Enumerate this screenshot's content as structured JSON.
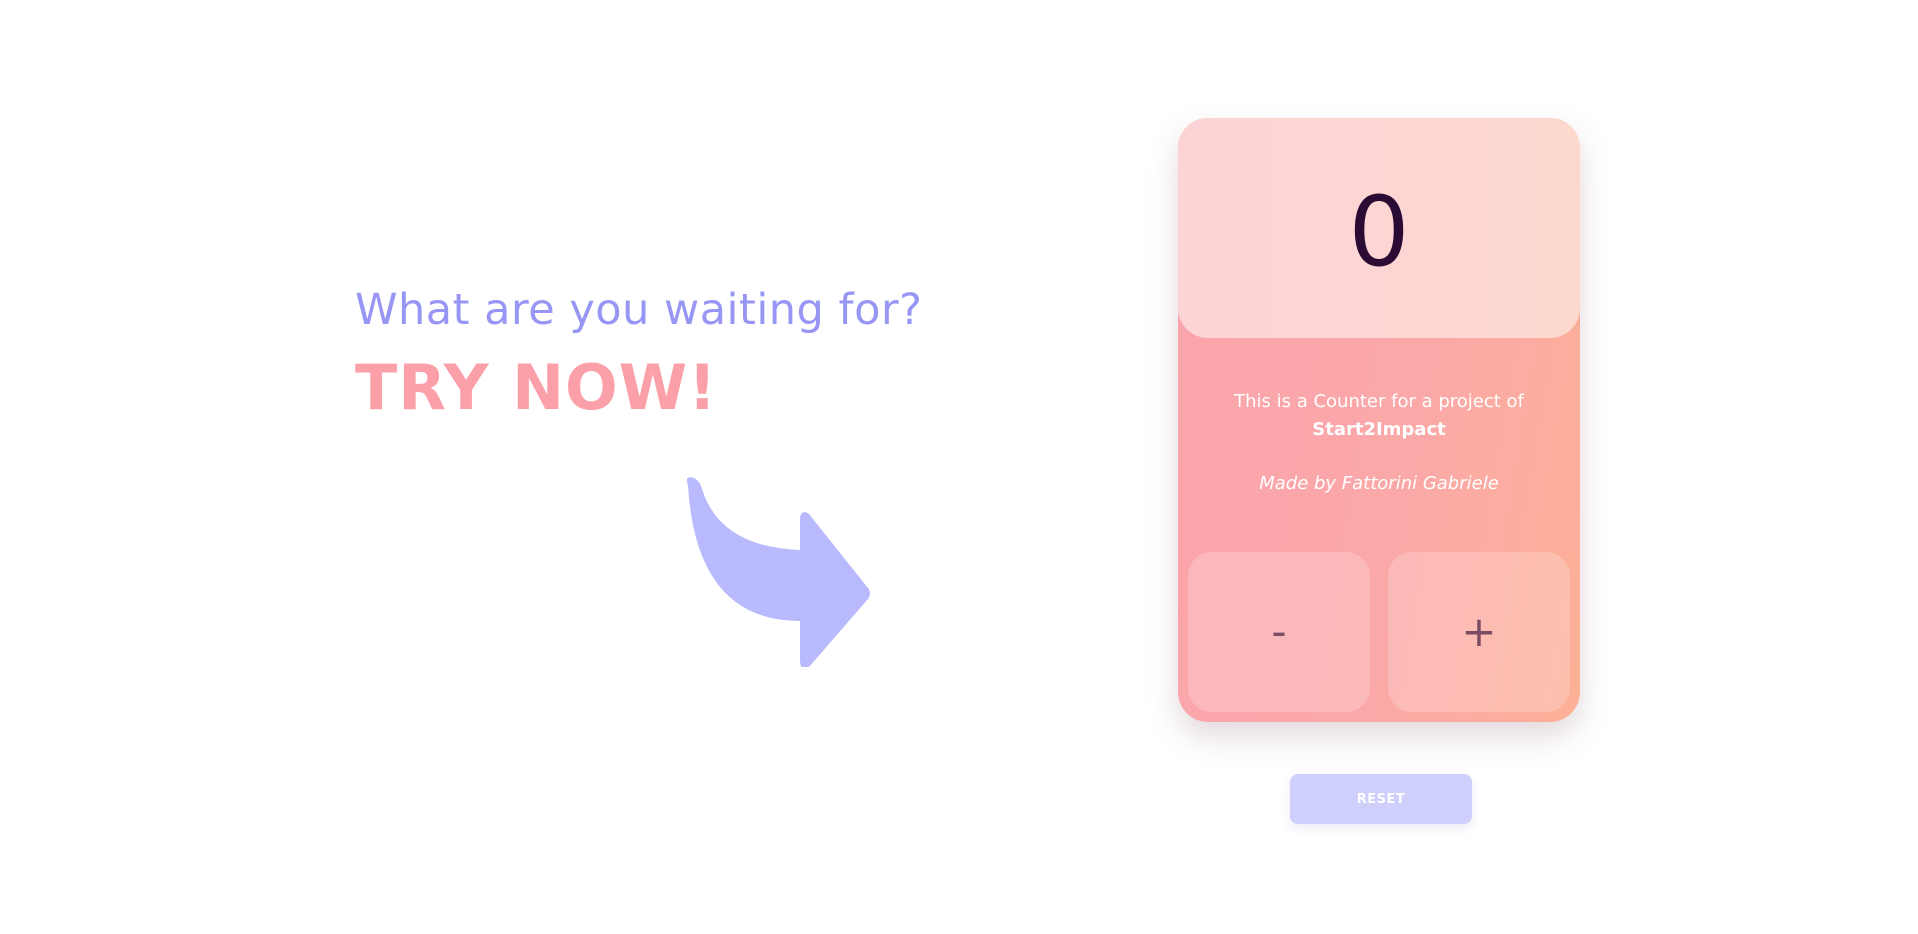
{
  "promo": {
    "question": "What are you waiting for?",
    "cta": "TRY NOW!",
    "arrow_icon": "curved-arrow-right-icon"
  },
  "counter": {
    "value": "0",
    "description": "This is a Counter for a project of",
    "brand": "Start2Impact",
    "author": "Made by Fattorini Gabriele",
    "decrement_label": "-",
    "increment_label": "+",
    "reset_label": "RESET"
  },
  "colors": {
    "question": "#9896f5",
    "cta": "#fba0a8",
    "arrow": "#b9b9fd",
    "counter_value": "#2a0b34",
    "reset_button": "#cfcffc"
  }
}
